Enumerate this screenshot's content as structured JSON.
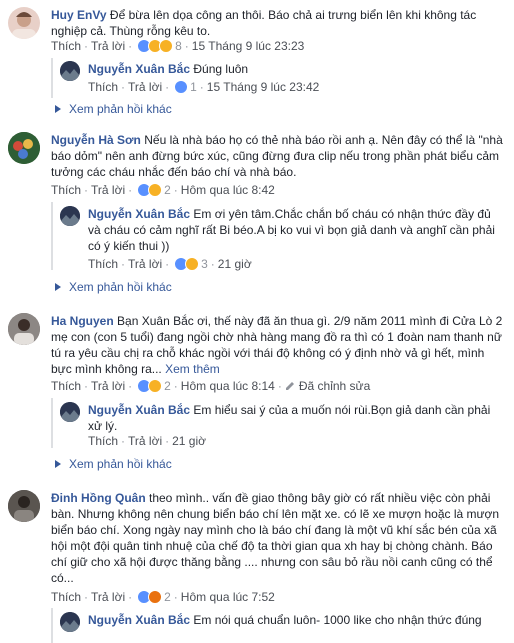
{
  "labels": {
    "like": "Thích",
    "reply": "Trả lời",
    "view_more_replies": "Xem phản hồi khác",
    "edit": "Đã chỉnh sửa",
    "see_more": "Xem thêm"
  },
  "c1": {
    "author": "Huy EnVy",
    "text": "Để bừa lên dọa công an thôi. Báo chả ai trưng biển lên khi không tác nghiệp cả. Thùng rỗng kêu to.",
    "reactions": "8",
    "time": "15 Tháng 9 lúc 23:23"
  },
  "r1": {
    "author": "Nguyễn Xuân Bắc",
    "text": "Đúng luôn",
    "reactions": "1",
    "time": "15 Tháng 9 lúc 23:42"
  },
  "c2": {
    "author": "Nguyễn Hà Sơn",
    "text": "Nếu là nhà báo họ có thẻ nhà báo rồi anh ạ. Nên đây có thể là \"nhà báo dỏm\" nên anh đừng bức xúc, cũng đừng đưa clip nếu trong phần phát biểu cảm tưởng các cháu nhắc đến báo chí và nhà báo.",
    "reactions": "2",
    "time": "Hôm qua lúc 8:42"
  },
  "r2": {
    "author": "Nguyễn Xuân Bắc",
    "text": "Em ơi yên tâm.Chắc chắn bố cháu có nhận thức đầy đủ và cháu có cảm nghĩ rất Bi béo.A bị ko vui vì bọn giả danh và anghĩ cần phải có ý kiến thui ))",
    "reactions": "3",
    "time": "21 giờ"
  },
  "c3": {
    "author": "Ha Nguyen",
    "text": "Bạn Xuân Bắc ơi, thế này đã ăn thua gì. 2/9 năm 2011 mình đi Cửa Lò 2 mẹ con (con 5 tuổi) đang ngồi chờ nhà hàng mang đồ ra thì có 1 đoàn nam thanh nữ tú ra yêu cầu chị ra chỗ khác ngồi với thái độ không có ý định nhờ vả gì hết, mình bực mình không ra...",
    "reactions": "2",
    "time": "Hôm qua lúc 8:14"
  },
  "r3": {
    "author": "Nguyễn Xuân Bắc",
    "text": "Em hiểu sai ý của a muốn nói rùi.Bọn giả danh cần phải xử lý.",
    "time": "21 giờ"
  },
  "c4": {
    "author": "Đinh Hồng Quân",
    "text": "theo mình.. vấn đề giao thông bây giờ có rất nhiều việc còn phải bàn. Nhưng không nên chung biển báo chí lên mặt xe. có lẽ xe mượn hoặc là mượn biển báo chí. Xong ngày nay mình cho là báo chí đang là một vũ khí sắc bén của xã hội một đội quân tinh nhuệ của chế độ ta thời gian qua xh hay bị chòng chành. Báo chí giữ cho xã hội được thăng bằng .... nhưng con sâu bỏ rầu nồi canh cũng có thể có...",
    "reactions": "2",
    "time": "Hôm qua lúc 7:52"
  },
  "r4": {
    "author": "Nguyễn Xuân Bắc",
    "text": "Em nói quá chuẩn luôn- 1000 like cho nhận thức đúng"
  },
  "colors": {
    "link": "#365899",
    "meta": "#90949c",
    "text": "#1d2129",
    "like": "#5890ff",
    "emoji": "#f7b125"
  }
}
